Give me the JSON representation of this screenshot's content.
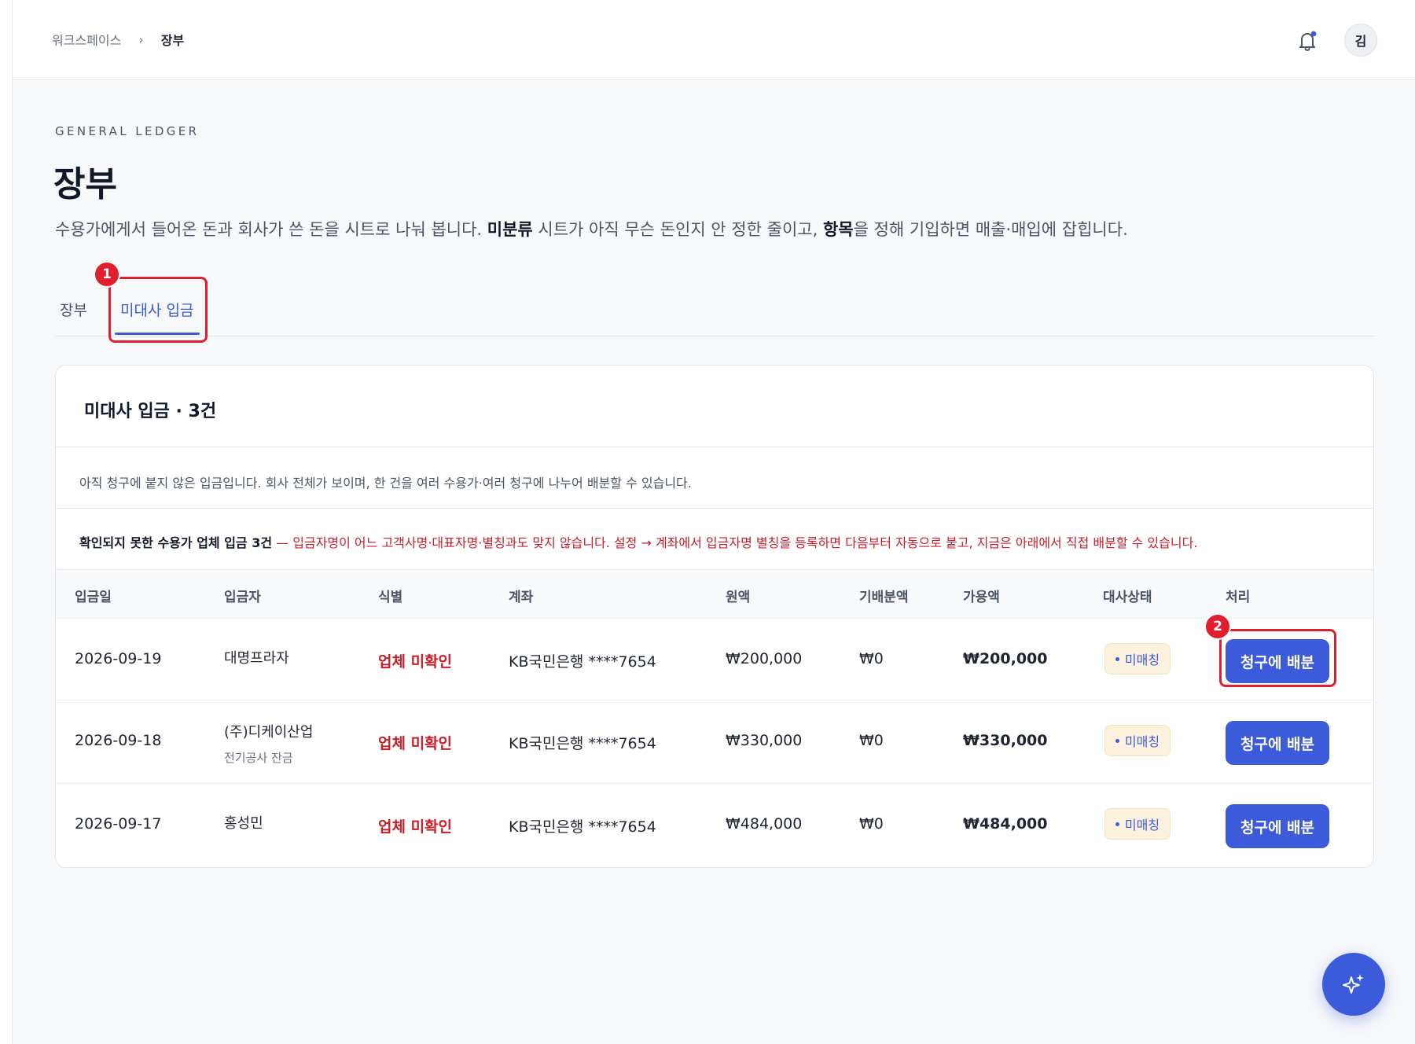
{
  "breadcrumb": {
    "root": "워크스페이스",
    "separator": "›",
    "current": "장부"
  },
  "header": {
    "avatar_initial": "김"
  },
  "page": {
    "eyebrow": "GENERAL LEDGER",
    "title": "장부",
    "desc_part1": "수용가에게서 들어온 돈과 회사가 쓴 돈을 시트로 나눠 봅니다. ",
    "desc_bold1": "미분류",
    "desc_part2": " 시트가 아직 무슨 돈인지 안 정한 줄이고, ",
    "desc_bold2": "항목",
    "desc_part3": "을 정해 기입하면 매출·매입에 잡힙니다."
  },
  "tabs": [
    {
      "label": "장부",
      "active": false
    },
    {
      "label": "미대사 입금",
      "active": true
    }
  ],
  "annotations": [
    "1",
    "2"
  ],
  "card": {
    "title": "미대사 입금 · 3건",
    "note": "아직 청구에 붙지 않은 입금입니다. 회사 전체가 보이며, 한 건을 여러 수용가·여러 청구에 나누어 배분할 수 있습니다.",
    "warn_bold": "확인되지 못한 수용가 업체 입금 3건",
    "warn_text": " — 입금자명이 어느 고객사명·대표자명·별칭과도 맞지 않습니다. 설정 → 계좌에서 입금자명 별칭을 등록하면 다음부터 자동으로 붙고, 지금은 아래에서 직접 배분할 수 있습니다."
  },
  "table": {
    "columns": [
      "입금일",
      "입금자",
      "식별",
      "계좌",
      "원액",
      "기배분액",
      "가용액",
      "대사상태",
      "처리"
    ],
    "rows": [
      {
        "date": "2026-09-19",
        "payer": "대명프라자",
        "payer_sub": "",
        "ident": "업체 미확인",
        "account": "KB국민은행 ****7654",
        "amount": "₩200,000",
        "allocated": "₩0",
        "available": "₩200,000",
        "status": "미매칭",
        "action": "청구에 배분"
      },
      {
        "date": "2026-09-18",
        "payer": "(주)디케이산업",
        "payer_sub": "전기공사 잔금",
        "ident": "업체 미확인",
        "account": "KB국민은행 ****7654",
        "amount": "₩330,000",
        "allocated": "₩0",
        "available": "₩330,000",
        "status": "미매칭",
        "action": "청구에 배분"
      },
      {
        "date": "2026-09-17",
        "payer": "홍성민",
        "payer_sub": "",
        "ident": "업체 미확인",
        "account": "KB국민은행 ****7654",
        "amount": "₩484,000",
        "allocated": "₩0",
        "available": "₩484,000",
        "status": "미매칭",
        "action": "청구에 배분"
      }
    ]
  },
  "icons": {
    "bell": "bell-icon",
    "fab": "sparkle-icon"
  },
  "colors": {
    "accent": "#3b5bdb",
    "danger": "#c81e2a",
    "highlight": "#e11d2e",
    "status_bg": "#fbf1dd"
  }
}
